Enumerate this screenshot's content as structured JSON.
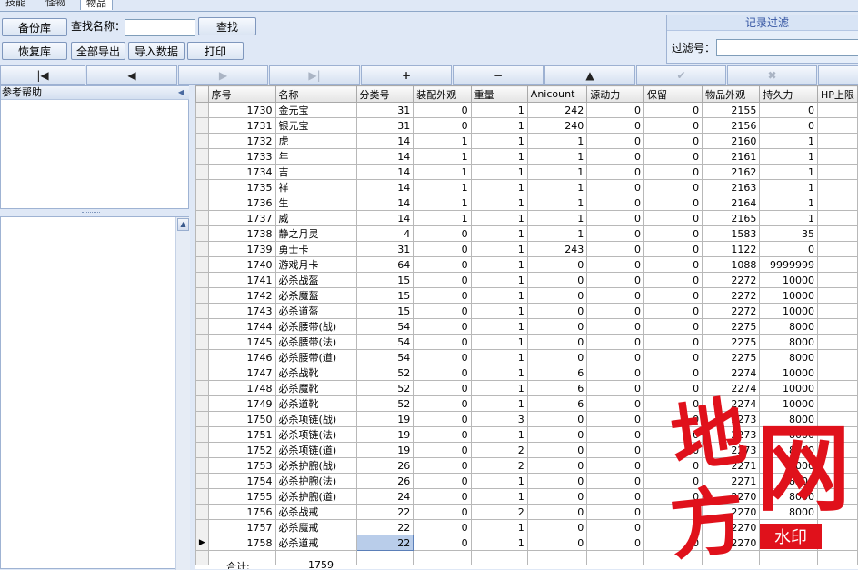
{
  "tabs": [
    "技能",
    "怪物",
    "物品"
  ],
  "toolbar": {
    "backup_label": "备份库",
    "restore_label": "恢复库",
    "search_name_label": "查找名称：",
    "search_value": "",
    "search_button": "查找",
    "export_all_label": "全部导出",
    "import_label": "导入数据",
    "print_label": "打印"
  },
  "filter": {
    "title": "记录过滤",
    "label": "过滤号：",
    "value": ""
  },
  "navigator": [
    "|◀",
    "◀",
    "▶",
    "▶|",
    "+",
    "−",
    "▲",
    "✔",
    "✖",
    ""
  ],
  "left": {
    "help_title": "参考帮助"
  },
  "grid": {
    "columns": [
      "序号",
      "名称",
      "分类号",
      "装配外观",
      "重量",
      "Anicount",
      "源动力",
      "保留",
      "物品外观",
      "持久力",
      "HP上限"
    ],
    "rows": [
      [
        "1730",
        "金元宝",
        "31",
        "0",
        "1",
        "242",
        "0",
        "0",
        "2155",
        "0",
        ""
      ],
      [
        "1731",
        "银元宝",
        "31",
        "0",
        "1",
        "240",
        "0",
        "0",
        "2156",
        "0",
        ""
      ],
      [
        "1732",
        "虎",
        "14",
        "1",
        "1",
        "1",
        "0",
        "0",
        "2160",
        "1",
        ""
      ],
      [
        "1733",
        "年",
        "14",
        "1",
        "1",
        "1",
        "0",
        "0",
        "2161",
        "1",
        ""
      ],
      [
        "1734",
        "吉",
        "14",
        "1",
        "1",
        "1",
        "0",
        "0",
        "2162",
        "1",
        ""
      ],
      [
        "1735",
        "祥",
        "14",
        "1",
        "1",
        "1",
        "0",
        "0",
        "2163",
        "1",
        ""
      ],
      [
        "1736",
        "生",
        "14",
        "1",
        "1",
        "1",
        "0",
        "0",
        "2164",
        "1",
        ""
      ],
      [
        "1737",
        "威",
        "14",
        "1",
        "1",
        "1",
        "0",
        "0",
        "2165",
        "1",
        ""
      ],
      [
        "1738",
        "静之月灵",
        "4",
        "0",
        "1",
        "1",
        "0",
        "0",
        "1583",
        "35",
        ""
      ],
      [
        "1739",
        "勇士卡",
        "31",
        "0",
        "1",
        "243",
        "0",
        "0",
        "1122",
        "0",
        ""
      ],
      [
        "1740",
        "游戏月卡",
        "64",
        "0",
        "1",
        "0",
        "0",
        "0",
        "1088",
        "9999999",
        ""
      ],
      [
        "1741",
        "必杀战盔",
        "15",
        "0",
        "1",
        "0",
        "0",
        "0",
        "2272",
        "10000",
        ""
      ],
      [
        "1742",
        "必杀魔盔",
        "15",
        "0",
        "1",
        "0",
        "0",
        "0",
        "2272",
        "10000",
        ""
      ],
      [
        "1743",
        "必杀道盔",
        "15",
        "0",
        "1",
        "0",
        "0",
        "0",
        "2272",
        "10000",
        ""
      ],
      [
        "1744",
        "必杀腰带(战)",
        "54",
        "0",
        "1",
        "0",
        "0",
        "0",
        "2275",
        "8000",
        ""
      ],
      [
        "1745",
        "必杀腰带(法)",
        "54",
        "0",
        "1",
        "0",
        "0",
        "0",
        "2275",
        "8000",
        ""
      ],
      [
        "1746",
        "必杀腰带(道)",
        "54",
        "0",
        "1",
        "0",
        "0",
        "0",
        "2275",
        "8000",
        ""
      ],
      [
        "1747",
        "必杀战靴",
        "52",
        "0",
        "1",
        "6",
        "0",
        "0",
        "2274",
        "10000",
        ""
      ],
      [
        "1748",
        "必杀魔靴",
        "52",
        "0",
        "1",
        "6",
        "0",
        "0",
        "2274",
        "10000",
        ""
      ],
      [
        "1749",
        "必杀道靴",
        "52",
        "0",
        "1",
        "6",
        "0",
        "0",
        "2274",
        "10000",
        ""
      ],
      [
        "1750",
        "必杀项链(战)",
        "19",
        "0",
        "3",
        "0",
        "0",
        "0",
        "2273",
        "8000",
        ""
      ],
      [
        "1751",
        "必杀项链(法)",
        "19",
        "0",
        "1",
        "0",
        "0",
        "0",
        "2273",
        "8000",
        ""
      ],
      [
        "1752",
        "必杀项链(道)",
        "19",
        "0",
        "2",
        "0",
        "0",
        "0",
        "2273",
        "8000",
        ""
      ],
      [
        "1753",
        "必杀护腕(战)",
        "26",
        "0",
        "2",
        "0",
        "0",
        "0",
        "2271",
        "8000",
        ""
      ],
      [
        "1754",
        "必杀护腕(法)",
        "26",
        "0",
        "1",
        "0",
        "0",
        "0",
        "2271",
        "8000",
        ""
      ],
      [
        "1755",
        "必杀护腕(道)",
        "24",
        "0",
        "1",
        "0",
        "0",
        "0",
        "2270",
        "8000",
        ""
      ],
      [
        "1756",
        "必杀战戒",
        "22",
        "0",
        "2",
        "0",
        "0",
        "0",
        "2270",
        "8000",
        ""
      ],
      [
        "1757",
        "必杀魔戒",
        "22",
        "0",
        "1",
        "0",
        "0",
        "0",
        "2270",
        "8000",
        ""
      ],
      [
        "1758",
        "必杀道戒",
        "22",
        "0",
        "1",
        "0",
        "0",
        "0",
        "2270",
        "8000",
        ""
      ]
    ],
    "current_row": "▶",
    "footer_label": "合计:",
    "footer_value": "1759"
  },
  "watermark": {
    "chars": [
      "地",
      "方",
      "网"
    ],
    "tag": "水印"
  },
  "colors": {
    "background": "#dfe8f6",
    "watermark": "#e0111b"
  }
}
